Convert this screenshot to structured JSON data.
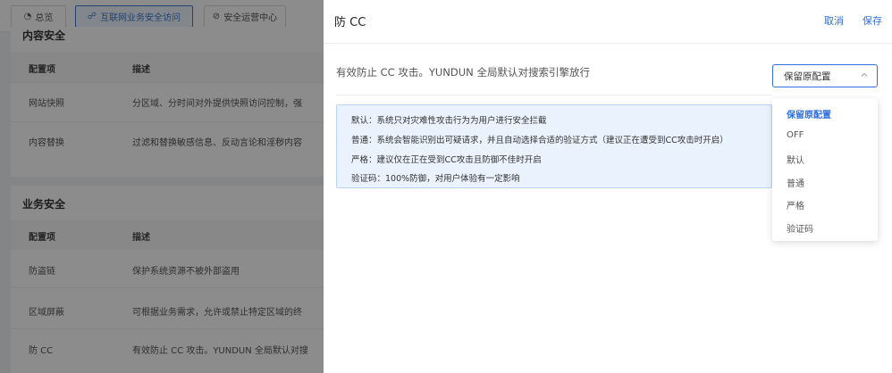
{
  "nav": {
    "tabs": [
      {
        "icon": "◔",
        "label": "总览"
      },
      {
        "icon": "☍",
        "label": "互联网业务安全访问"
      },
      {
        "icon": "⊘",
        "label": "安全运营中心"
      }
    ]
  },
  "content_security": {
    "title": "内容安全",
    "col_item": "配置项",
    "col_desc": "描述",
    "rows": [
      {
        "item": "网站快照",
        "desc": "分区域、分时间对外提供快照访问控制，强"
      },
      {
        "item": "内容替换",
        "desc": "过滤和替换敏感信息、反动言论和淫秽内容"
      }
    ]
  },
  "business_security": {
    "title": "业务安全",
    "col_item": "配置项",
    "col_desc": "描述",
    "rows": [
      {
        "item": "防盗链",
        "desc": "保护系统资源不被外部盗用"
      },
      {
        "item": "区域屏蔽",
        "desc": "可根据业务需求，允许或禁止特定区域的终"
      },
      {
        "item": "防 CC",
        "desc": "有效防止 CC 攻击。YUNDUN 全局默认对搜"
      }
    ]
  },
  "drawer": {
    "title": "防 CC",
    "cancel": "取消",
    "save": "保存",
    "description": "有效防止 CC 攻击。YUNDUN 全局默认对搜索引擎放行",
    "select_value": "保留原配置",
    "info_lines": [
      "默认：系统只对灾难性攻击行为为用户进行安全拦截",
      "普通：系统会智能识别出可疑请求，并且自动选择合适的验证方式（建议正在遭受到CC攻击时开启）",
      "严格：建议仅在正在受到CC攻击且防御不佳时开启",
      "验证码：100%防御，对用户体验有一定影响"
    ],
    "options": [
      "保留原配置",
      "OFF",
      "默认",
      "普通",
      "严格",
      "验证码"
    ],
    "selected_option": "保留原配置"
  }
}
